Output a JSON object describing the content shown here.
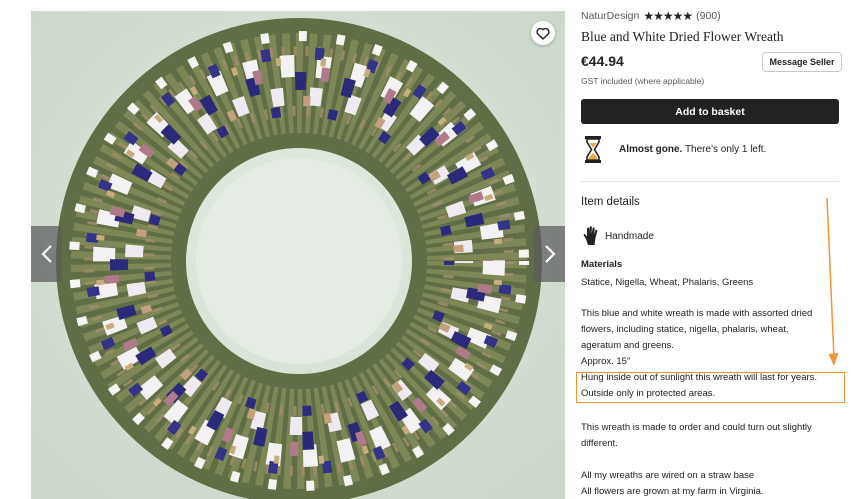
{
  "listing": {
    "shop_name": "NaturDesign",
    "rating_stars": "★★★★★",
    "review_count": "(900)",
    "title": "Blue and White Dried Flower Wreath",
    "price": "€44.94",
    "tax_note": "GST included (where applicable)",
    "message_button": "Message Seller",
    "basket_button": "Add to basket",
    "stock_bold": "Almost gone.",
    "stock_rest": " There's only 1 left."
  },
  "details": {
    "heading": "Item details",
    "handmade": "Handmade",
    "materials_heading": "Materials",
    "materials": "Statice, Nigella, Wheat, Phalaris, Greens",
    "description_lines": [
      "This blue and white wreath is made with assorted dried",
      "flowers, including statice, nigella, phalaris, wheat,",
      "ageratum and greens.",
      "Approx. 15\"",
      "Hung inside out of sunlight this wreath will last for years.",
      "Outside only in protected areas.",
      "This wreath is made to order and could turn out slightly",
      "different.",
      "All my wreaths are wired on a straw base",
      "All flowers are grown at my farm in Virginia."
    ]
  },
  "colors": {
    "accent_annotation": "#f0973a",
    "button_dark": "#222222"
  },
  "icons": {
    "favorite": "heart-icon",
    "prev": "chevron-left-icon",
    "next": "chevron-right-icon",
    "stock": "hourglass-icon",
    "handmade": "hand-icon"
  }
}
